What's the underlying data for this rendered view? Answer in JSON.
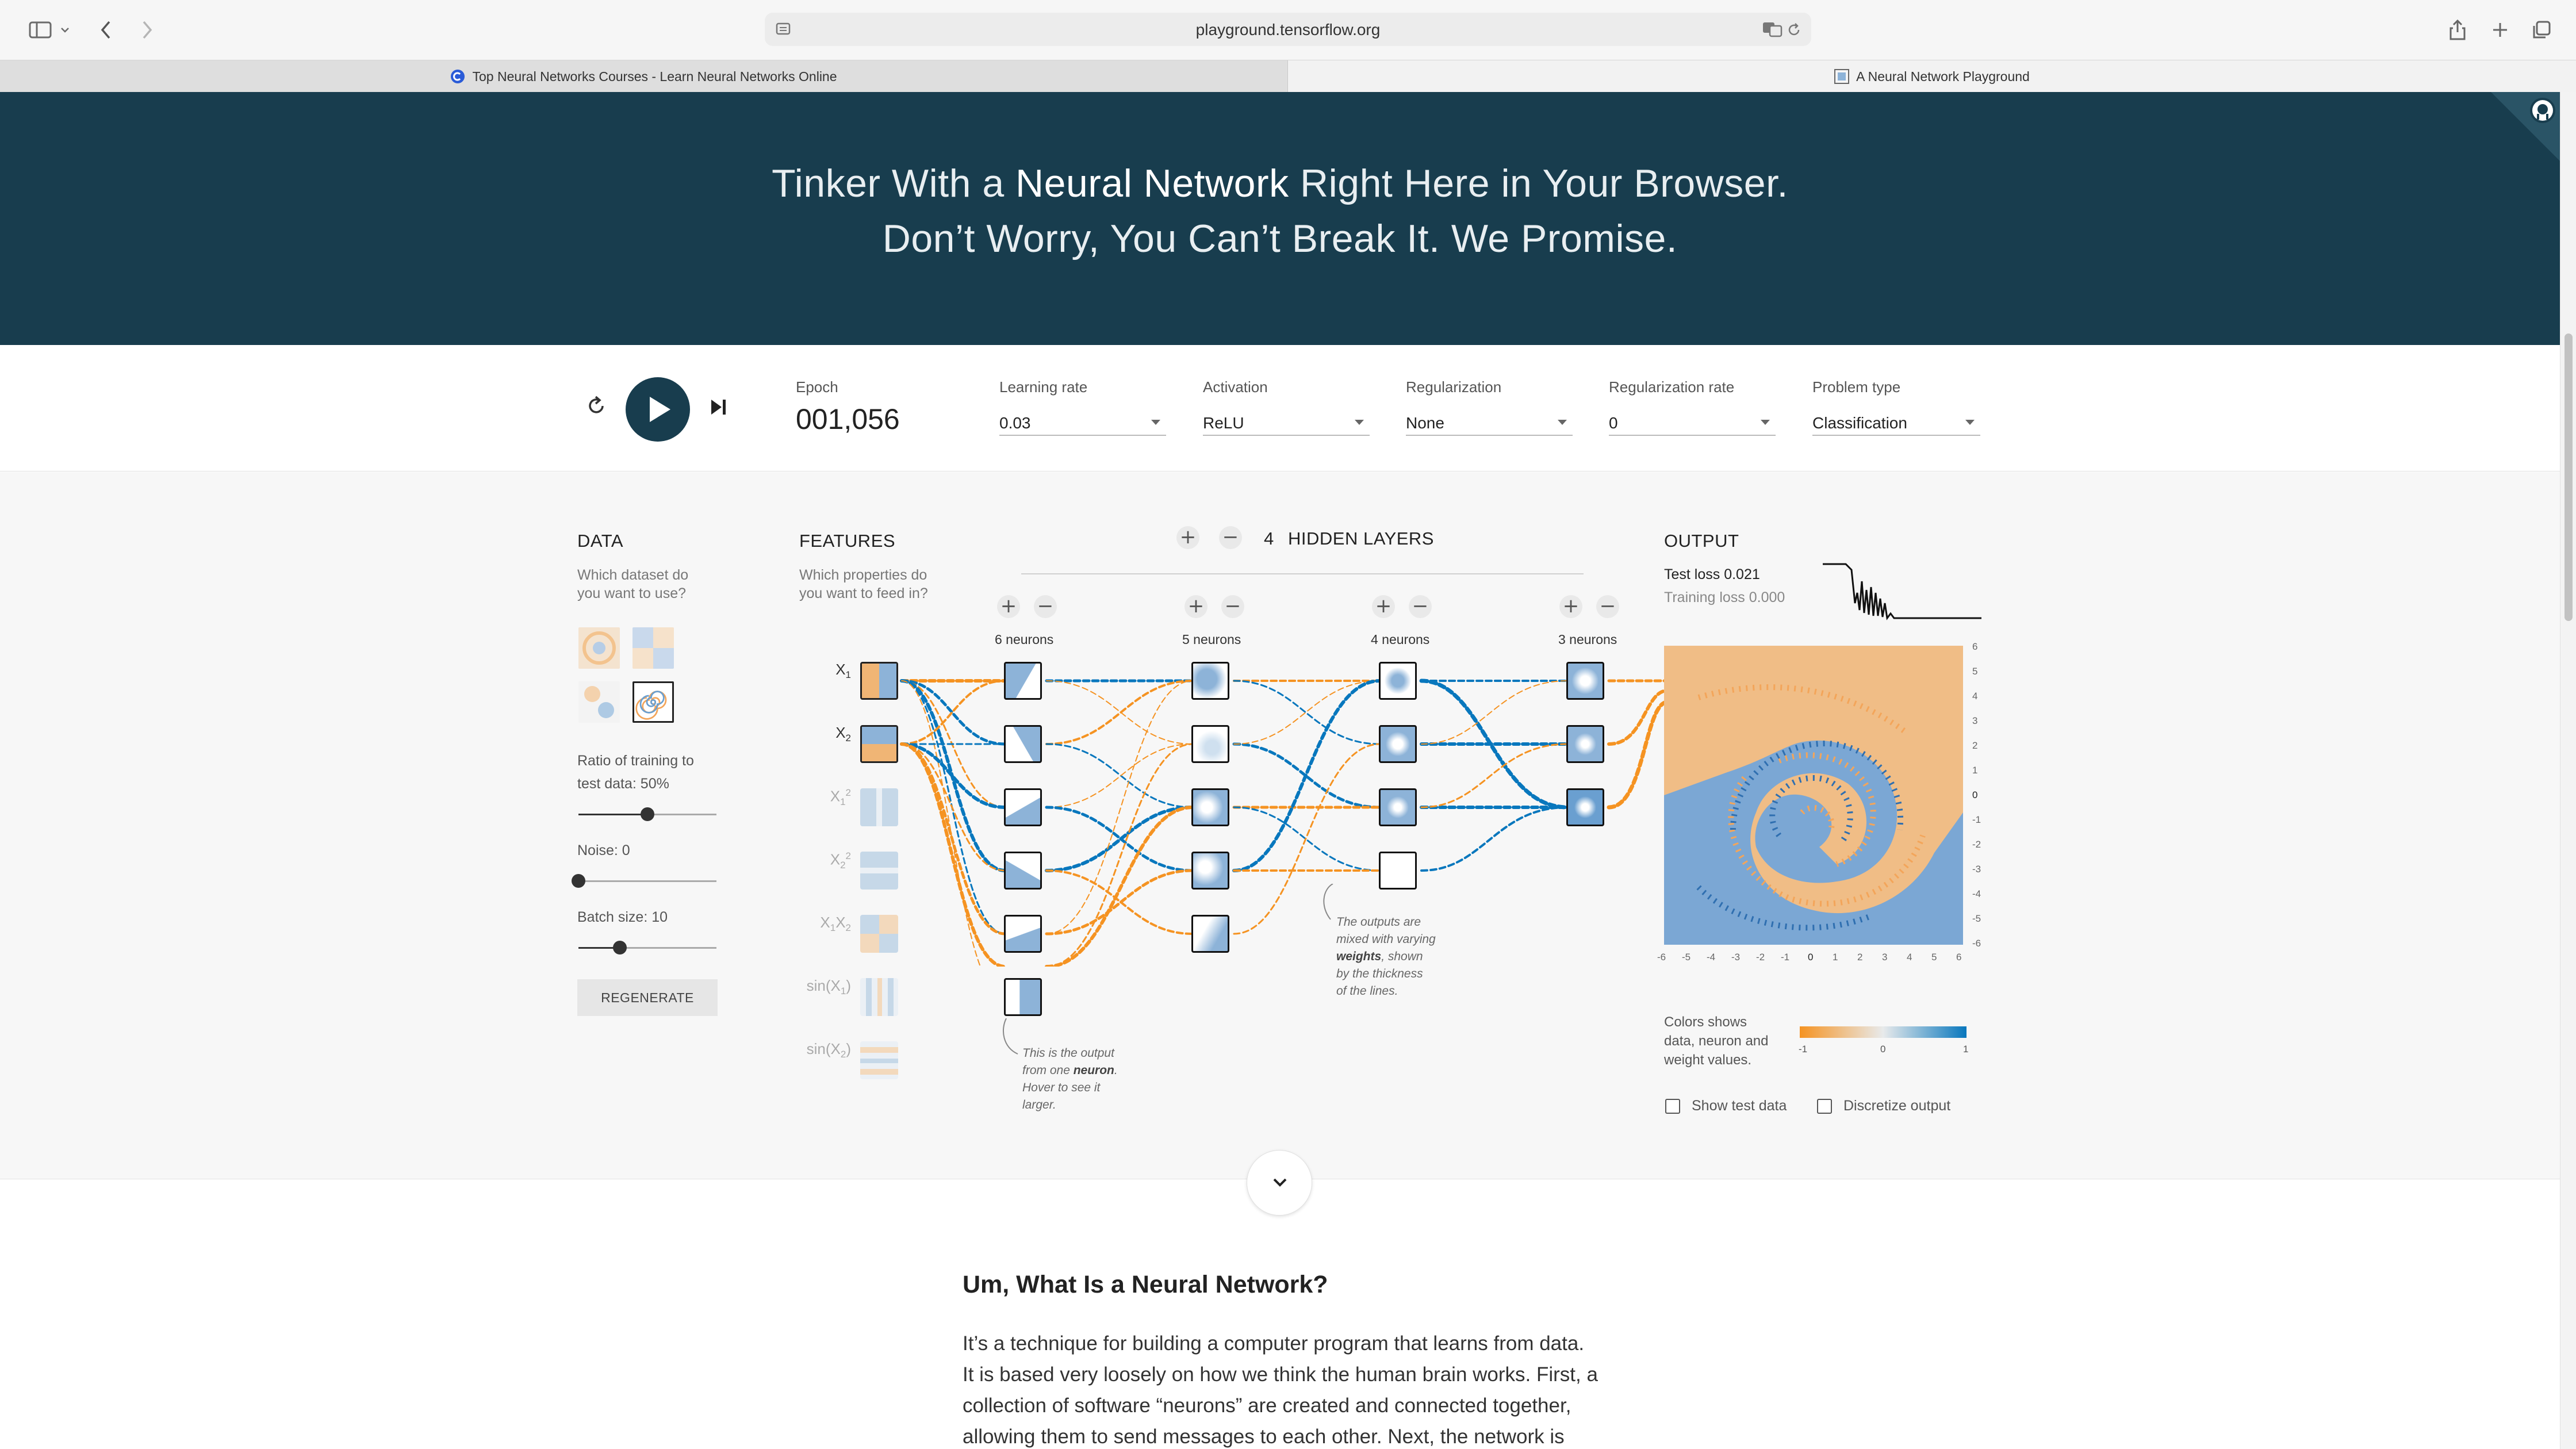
{
  "browser": {
    "url": "playground.tensorflow.org",
    "tabs": [
      {
        "title": "Top Neural Networks Courses - Learn Neural Networks Online",
        "active": false,
        "favicon": "c-logo-icon"
      },
      {
        "title": "A Neural Network Playground",
        "active": true,
        "favicon": "playground-favicon"
      }
    ]
  },
  "hero": {
    "line1_pre": "Tinker With a ",
    "line1_bold": "Neural Network",
    "line1_post": " Right Here in Your Browser.",
    "line2": "Don’t Worry, You Can’t Break It. We Promise."
  },
  "controls": {
    "epoch_label": "Epoch",
    "epoch_value": "001,056",
    "learning_rate": {
      "label": "Learning rate",
      "value": "0.03"
    },
    "activation": {
      "label": "Activation",
      "value": "ReLU"
    },
    "regularization": {
      "label": "Regularization",
      "value": "None"
    },
    "regularization_rate": {
      "label": "Regularization rate",
      "value": "0"
    },
    "problem_type": {
      "label": "Problem type",
      "value": "Classification"
    }
  },
  "data_panel": {
    "title": "DATA",
    "subtitle_1": "Which dataset do",
    "subtitle_2": "you want to use?",
    "ratio_label_1": "Ratio of training to",
    "ratio_label_2": "test data:  50%",
    "ratio_value": 0.5,
    "noise_label": "Noise:  0",
    "noise_value": 0,
    "batch_label": "Batch size:  10",
    "batch_value": 0.3,
    "regenerate_label": "REGENERATE",
    "selected_dataset": "spiral"
  },
  "features_panel": {
    "title": "FEATURES",
    "subtitle_1": "Which properties do",
    "subtitle_2": "you want to feed in?",
    "features": [
      {
        "base": "X",
        "sub": "1",
        "sup": "",
        "active": true
      },
      {
        "base": "X",
        "sub": "2",
        "sup": "",
        "active": true
      },
      {
        "base": "X",
        "sub": "1",
        "sup": "2",
        "active": false
      },
      {
        "base": "X",
        "sub": "2",
        "sup": "2",
        "active": false
      },
      {
        "base": "X",
        "sub": "1",
        "sup": "",
        "base2": "X",
        "sub2": "2",
        "active": false
      },
      {
        "base": "sin(X",
        "sub": "1",
        "sup": "",
        "close": ")",
        "active": false
      },
      {
        "base": "sin(X",
        "sub": "2",
        "sup": "",
        "close": ")",
        "active": false
      }
    ]
  },
  "network": {
    "hidden_layers_count": "4",
    "hidden_layers_label": "HIDDEN LAYERS",
    "layers": [
      {
        "label": "6 neurons",
        "count": 6
      },
      {
        "label": "5 neurons",
        "count": 5
      },
      {
        "label": "4 neurons",
        "count": 4
      },
      {
        "label": "3 neurons",
        "count": 3
      }
    ],
    "note_neuron_pre": "This is the output",
    "note_neuron_mid": "from one ",
    "note_neuron_bold": "neuron",
    "note_neuron_end": ".",
    "note_neuron_l3": "Hover to see it",
    "note_neuron_l4": "larger.",
    "note_weights_l1": "The outputs are",
    "note_weights_l2": "mixed with varying",
    "note_weights_bold": "weights",
    "note_weights_l3": ", shown",
    "note_weights_l4": "by the thickness",
    "note_weights_l5": "of the lines."
  },
  "output_panel": {
    "title": "OUTPUT",
    "test_loss": "Test loss 0.021",
    "training_loss": "Training loss 0.000",
    "x_ticks": [
      "-6",
      "-5",
      "-4",
      "-3",
      "-2",
      "-1",
      "0",
      "1",
      "2",
      "3",
      "4",
      "5",
      "6"
    ],
    "y_ticks": [
      "6",
      "5",
      "4",
      "3",
      "2",
      "1",
      "0",
      "-1",
      "-2",
      "-3",
      "-4",
      "-5",
      "-6"
    ],
    "legend_text_1": "Colors shows",
    "legend_text_2": "data, neuron and",
    "legend_text_3": "weight values.",
    "legend_min": "-1",
    "legend_mid": "0",
    "legend_max": "1",
    "show_test_label": "Show test data",
    "discretize_label": "Discretize output",
    "colors": {
      "orange": "#f59322",
      "blue": "#0877bd",
      "light_orange": "#f0c08a",
      "light_blue": "#8db3d8"
    }
  },
  "article": {
    "heading": "Um, What Is a Neural Network?",
    "body": "It’s a technique for building a computer program that learns from data. It is based very loosely on how we think the human brain works. First, a collection of software “neurons” are created and connected together, allowing them to send messages to each other. Next, the network is"
  }
}
